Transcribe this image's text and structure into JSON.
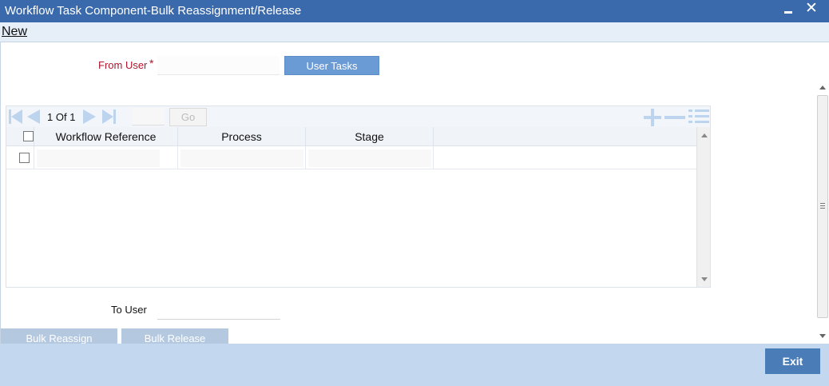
{
  "window": {
    "title": "Workflow Task Component-Bulk Reassignment/Release",
    "close_glyph": "✕"
  },
  "menu": {
    "new_label": "New"
  },
  "form": {
    "from_user_label": "From User",
    "required_mark": "*",
    "from_user_value": "",
    "user_tasks_label": "User Tasks",
    "to_user_label": "To User",
    "to_user_value": ""
  },
  "grid": {
    "pager": {
      "current_page": "1",
      "of_label": "Of",
      "total_pages": "1",
      "page_input_value": "",
      "go_label": "Go"
    },
    "columns": [
      "Workflow Reference",
      "Process",
      "Stage"
    ],
    "rows": [
      {
        "selected": false,
        "workflow_reference": "",
        "process": "",
        "stage": ""
      }
    ]
  },
  "actions": {
    "bulk_reassign_label": "Bulk Reassign",
    "bulk_release_label": "Bulk Release",
    "exit_label": "Exit"
  },
  "colors": {
    "title_bar": "#3a6aab",
    "required_label": "#b0162c",
    "primary_button": "#6b9bd4",
    "footer": "#c3d8ee",
    "exit_button": "#4a7db8"
  }
}
